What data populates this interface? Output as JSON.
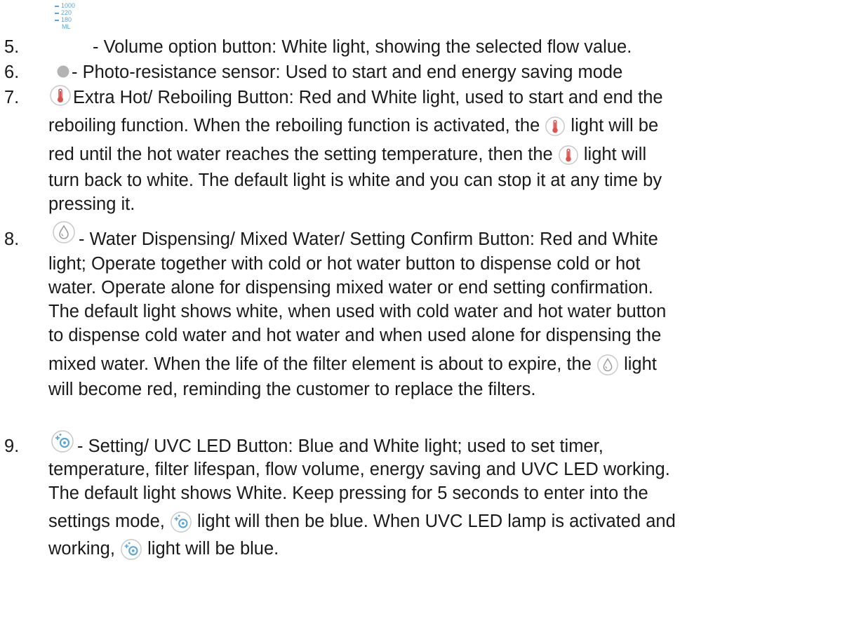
{
  "colors": {
    "text": "#1a1a1a",
    "icon_blue": "#5aa6d6",
    "thermo_red": "#d9534f",
    "icon_ring": "#c8c8c8",
    "sensor_grey": "#b3b3b3"
  },
  "volume_icon": {
    "values": [
      "1000",
      "220",
      "180"
    ],
    "unit": "ML"
  },
  "items": [
    {
      "number": "5.",
      "icon": "volume-scale-icon",
      "lines": [
        " - Volume option button: White light, showing the selected flow value."
      ]
    },
    {
      "number": "6.",
      "icon": "photo-sensor-dot-icon",
      "lines": [
        " - Photo-resistance sensor: Used to start and end energy saving mode"
      ]
    },
    {
      "number": "7.",
      "icon": "thermometer-icon",
      "lines": [
        " Extra Hot/ Reboiling Button: Red and White light, used to start and end the",
        "reboiling function. When the reboiling function is activated, the ",
        " light will be",
        "red until the hot water reaches the setting temperature, then the ",
        " light will",
        "turn back to white. The default light is white and you can stop it at any time by",
        "pressing it."
      ]
    },
    {
      "number": "8.",
      "icon": "water-drop-icon",
      "lines": [
        " - Water Dispensing/ Mixed Water/ Setting Confirm Button: Red and White",
        "light; Operate together with cold or hot water button to dispense cold or hot",
        "water. Operate alone for dispensing mixed water or end setting confirmation.",
        "The default light shows white, when used with cold water and hot water button",
        "to dispense cold water and hot water and when used alone for dispensing the",
        "mixed water. When the life of the filter element is about to expire, the ",
        " light",
        "will become red, reminding the customer to replace the filters."
      ]
    },
    {
      "number": "9.",
      "icon": "uvc-setting-icon",
      "lines": [
        " - Setting/ UVC LED Button: Blue and White light; used to set timer,",
        "temperature, filter lifespan, flow volume, energy saving and UVC LED working.",
        "The default light shows White. Keep pressing for 5 seconds to enter into the",
        "settings mode, ",
        " light will then be blue. When UVC LED lamp is activated and",
        "working, ",
        " light will be blue."
      ]
    }
  ]
}
